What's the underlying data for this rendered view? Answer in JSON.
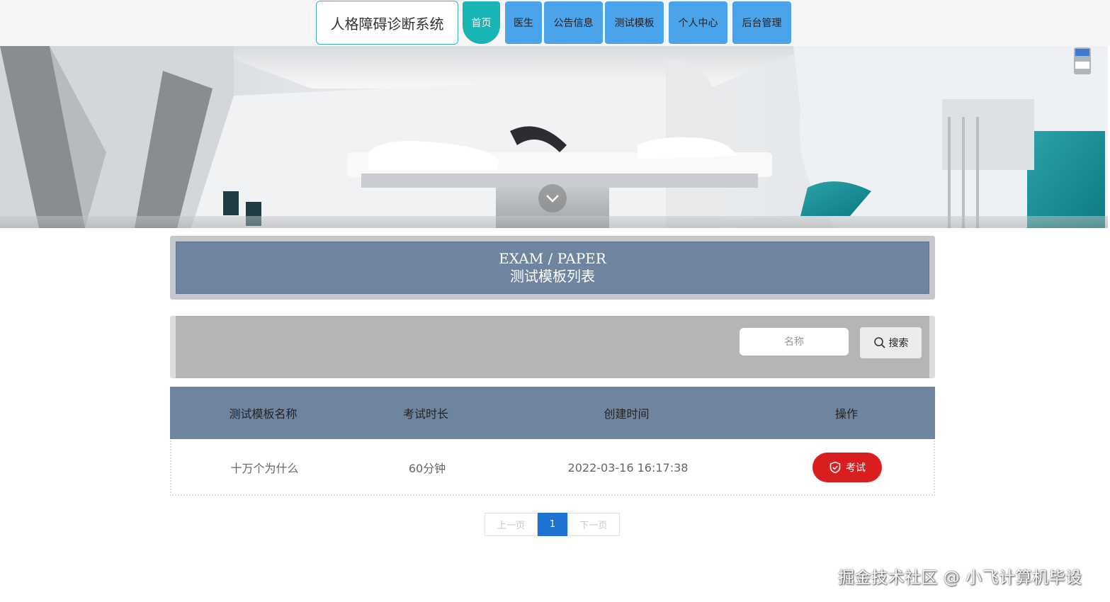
{
  "header": {
    "title": "人格障碍诊断系统",
    "nav": [
      {
        "label": "首页",
        "active": true
      },
      {
        "label": "医生",
        "active": false
      },
      {
        "label": "公告信息",
        "active": false
      },
      {
        "label": "测试模板",
        "active": false
      },
      {
        "label": "个人中心",
        "active": false
      },
      {
        "label": "后台管理",
        "active": false
      }
    ]
  },
  "hero": {
    "icons": {
      "scroll": "chevron-down-icon",
      "indicator": "carousel-indicator-icon"
    }
  },
  "section": {
    "title_en": "EXAM / PAPER",
    "title_cn": "测试模板列表"
  },
  "search": {
    "placeholder": "名称",
    "value": "",
    "button_label": "搜索",
    "icon": "search-icon"
  },
  "table": {
    "columns": [
      "测试模板名称",
      "考试时长",
      "创建时间",
      "操作"
    ],
    "rows": [
      {
        "name": "十万个为什么",
        "duration": "60分钟",
        "created": "2022-03-16 16:17:38",
        "action": "考试"
      }
    ],
    "action_icon": "shield-check-icon"
  },
  "pagination": {
    "prev": "上一页",
    "current": "1",
    "next": "下一页"
  },
  "watermark": "掘金技术社区 @ 小飞计算机毕设",
  "colors": {
    "nav_active": "#19b4b4",
    "nav_item": "#4ba3ea",
    "panel_header": "#6f859f",
    "exam_button": "#d81e1e",
    "pager_active": "#1e72d2"
  }
}
